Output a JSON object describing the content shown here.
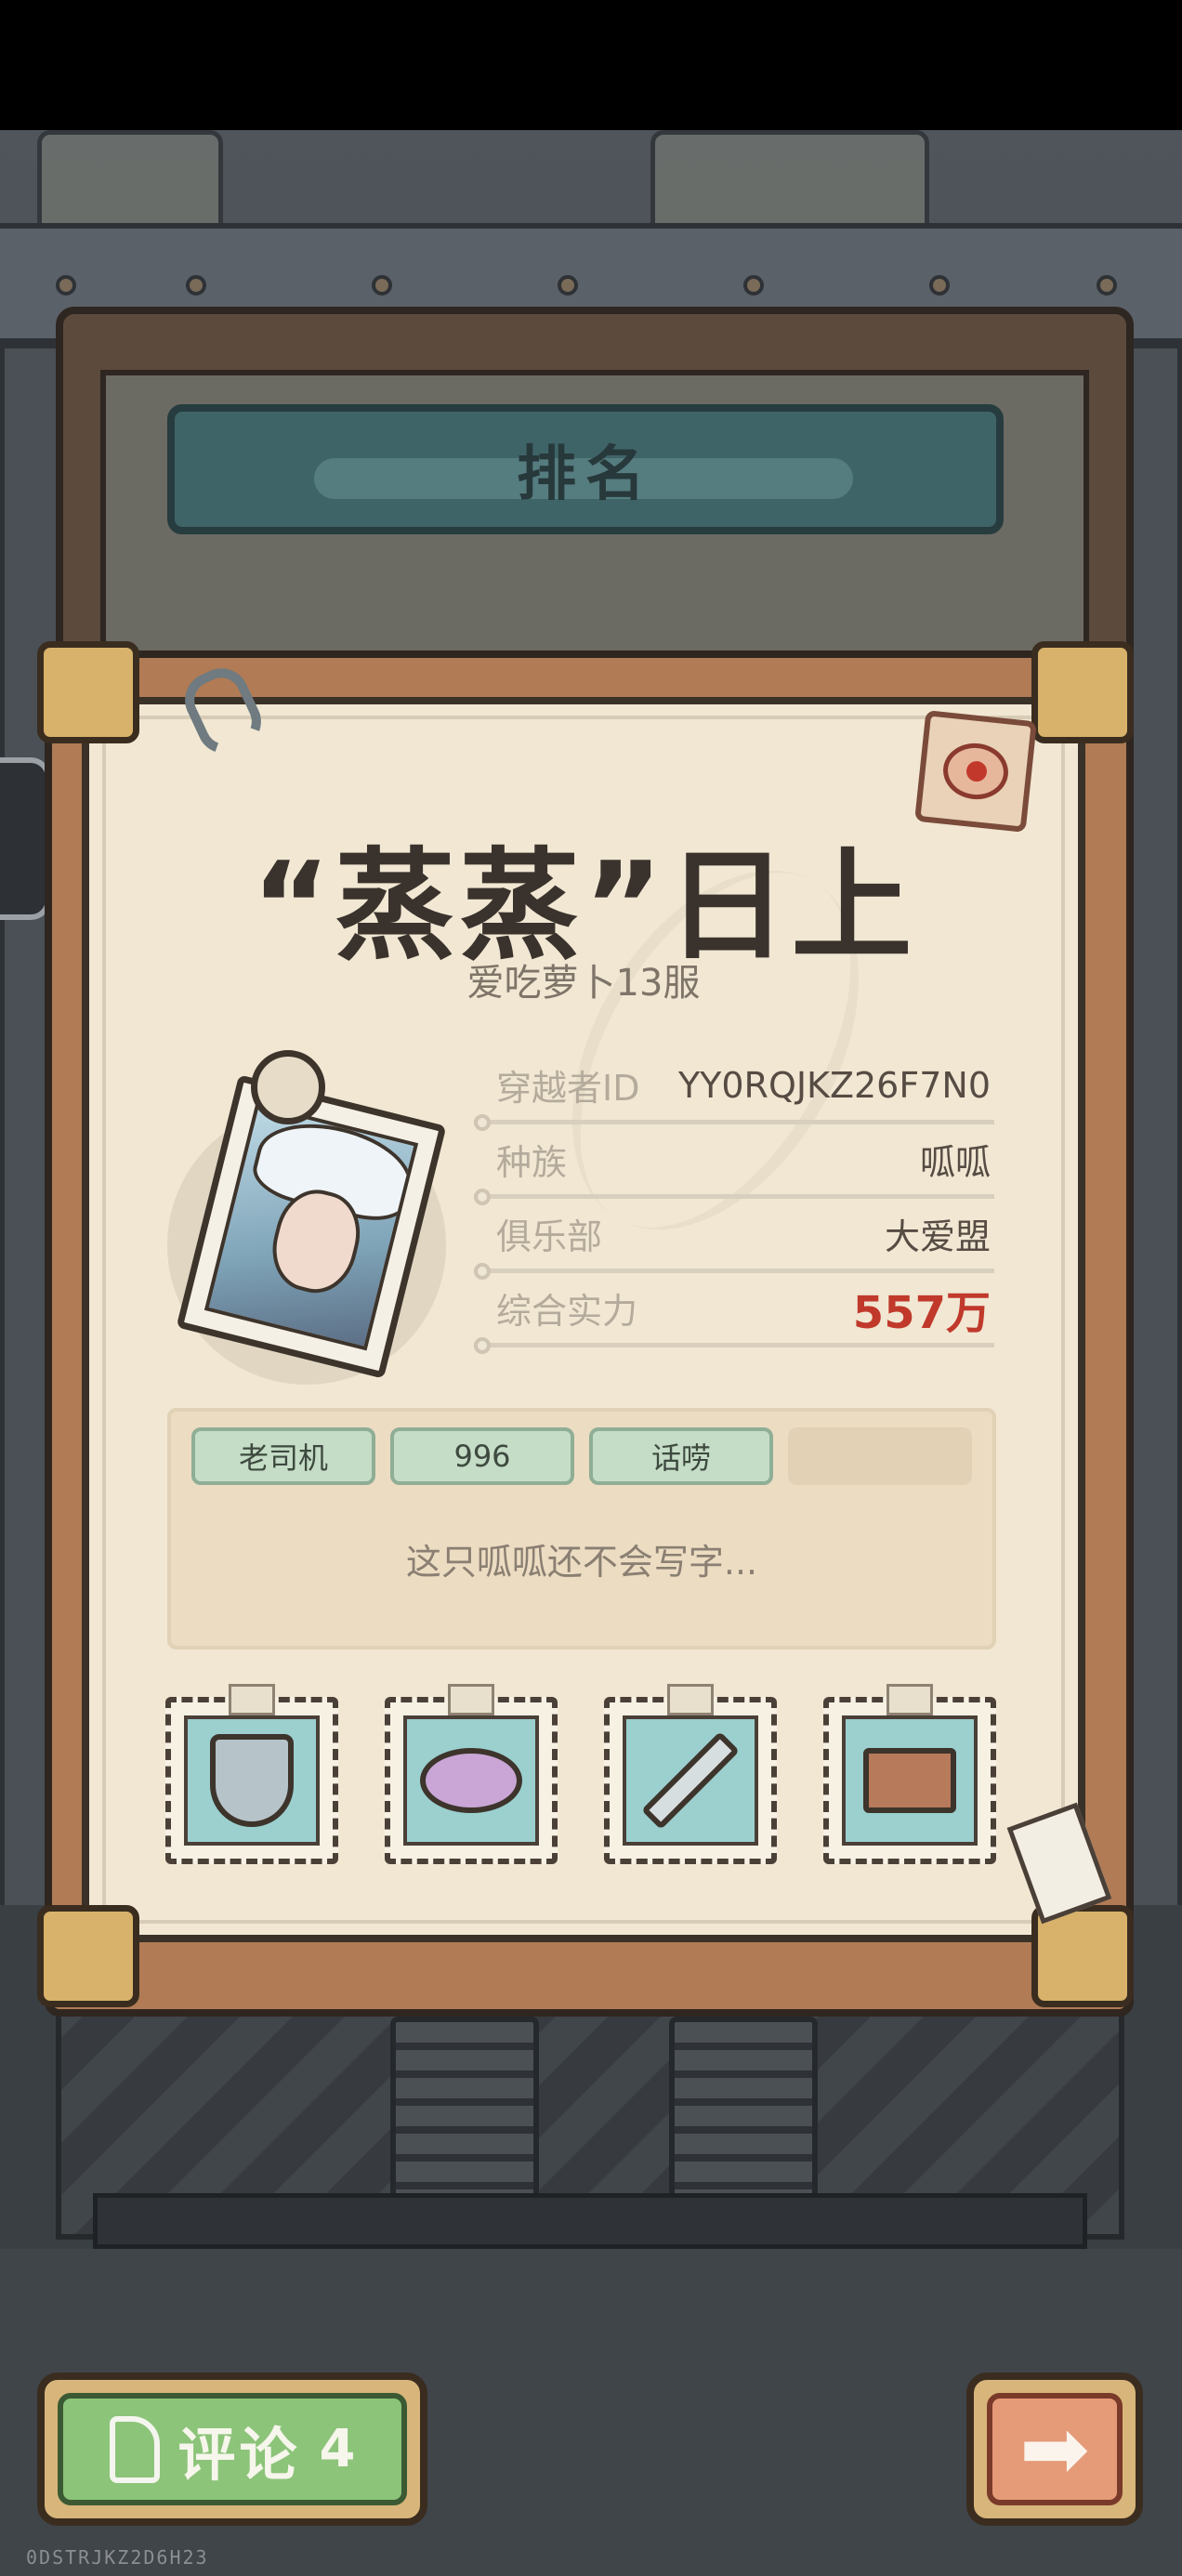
{
  "tab_title": "排名",
  "player": {
    "name": "“蒸蒸”日上",
    "server": "爱吃萝卜13服",
    "avatar_icon": "avatar-portrait",
    "badge_icon": "snail-icon"
  },
  "info": [
    {
      "label": "穿越者ID",
      "value": "YY0RQJKZ26F7N0"
    },
    {
      "label": "种族",
      "value": "呱呱"
    },
    {
      "label": "俱乐部",
      "value": "大爱盟"
    },
    {
      "label": "综合实力",
      "value": "557万"
    }
  ],
  "tags": [
    "老司机",
    "996",
    "话唠",
    ""
  ],
  "signature": "这只呱呱还不会写字...",
  "stamps": [
    "shield-icon",
    "winged-eye-icon",
    "crossed-swords-icon",
    "plant-pot-icon"
  ],
  "comment_button": {
    "label": "评论",
    "count": "4"
  },
  "next_button": {
    "icon": "arrow-right-icon"
  },
  "footer_code": "0DSTRJKZ2D6H23",
  "colors": {
    "power": "#c0392b",
    "card": "#f1e7d3",
    "tag": "#c5ddc6",
    "comment": "#8cc47a"
  }
}
